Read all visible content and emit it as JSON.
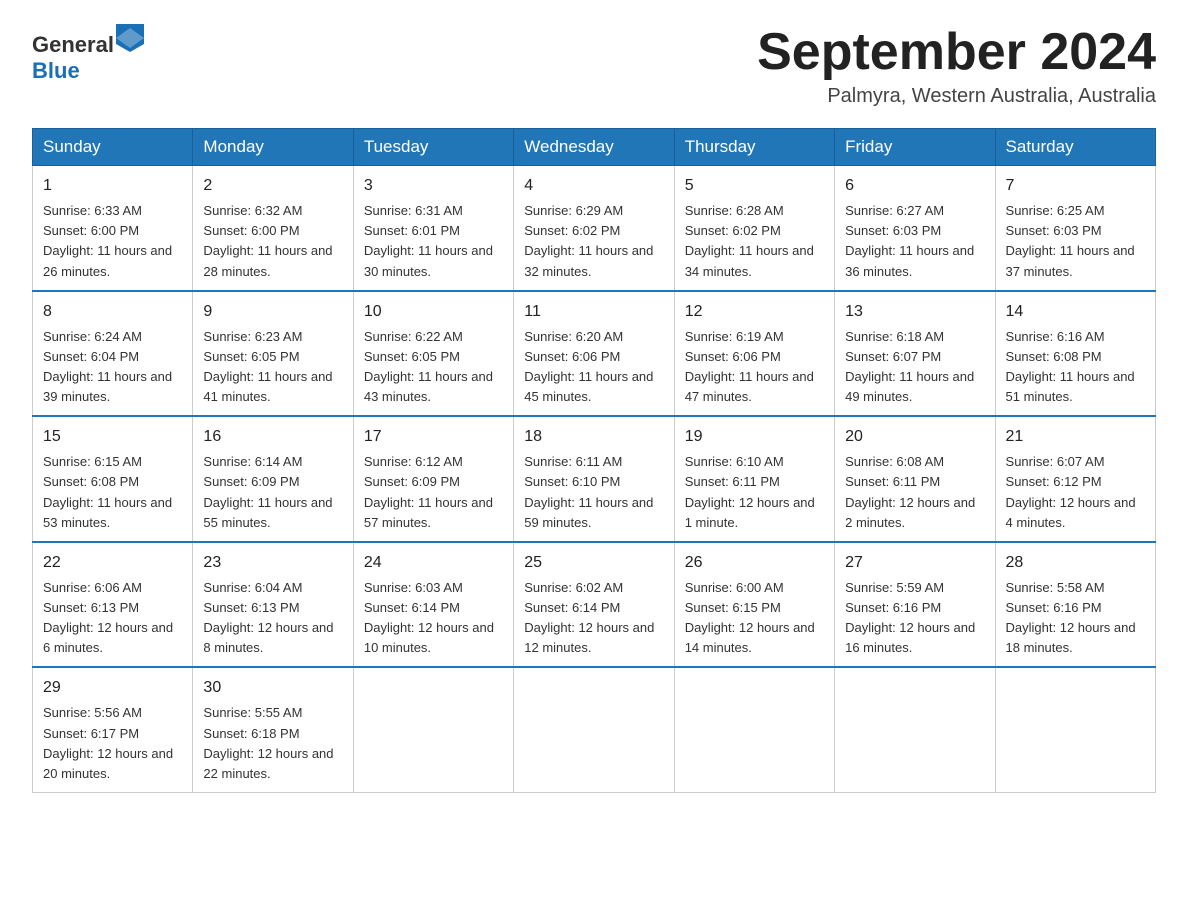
{
  "header": {
    "logo_general": "General",
    "logo_blue": "Blue",
    "month_year": "September 2024",
    "location": "Palmyra, Western Australia, Australia"
  },
  "days_of_week": [
    "Sunday",
    "Monday",
    "Tuesday",
    "Wednesday",
    "Thursday",
    "Friday",
    "Saturday"
  ],
  "weeks": [
    [
      {
        "day": "1",
        "sunrise": "6:33 AM",
        "sunset": "6:00 PM",
        "daylight": "11 hours and 26 minutes."
      },
      {
        "day": "2",
        "sunrise": "6:32 AM",
        "sunset": "6:00 PM",
        "daylight": "11 hours and 28 minutes."
      },
      {
        "day": "3",
        "sunrise": "6:31 AM",
        "sunset": "6:01 PM",
        "daylight": "11 hours and 30 minutes."
      },
      {
        "day": "4",
        "sunrise": "6:29 AM",
        "sunset": "6:02 PM",
        "daylight": "11 hours and 32 minutes."
      },
      {
        "day": "5",
        "sunrise": "6:28 AM",
        "sunset": "6:02 PM",
        "daylight": "11 hours and 34 minutes."
      },
      {
        "day": "6",
        "sunrise": "6:27 AM",
        "sunset": "6:03 PM",
        "daylight": "11 hours and 36 minutes."
      },
      {
        "day": "7",
        "sunrise": "6:25 AM",
        "sunset": "6:03 PM",
        "daylight": "11 hours and 37 minutes."
      }
    ],
    [
      {
        "day": "8",
        "sunrise": "6:24 AM",
        "sunset": "6:04 PM",
        "daylight": "11 hours and 39 minutes."
      },
      {
        "day": "9",
        "sunrise": "6:23 AM",
        "sunset": "6:05 PM",
        "daylight": "11 hours and 41 minutes."
      },
      {
        "day": "10",
        "sunrise": "6:22 AM",
        "sunset": "6:05 PM",
        "daylight": "11 hours and 43 minutes."
      },
      {
        "day": "11",
        "sunrise": "6:20 AM",
        "sunset": "6:06 PM",
        "daylight": "11 hours and 45 minutes."
      },
      {
        "day": "12",
        "sunrise": "6:19 AM",
        "sunset": "6:06 PM",
        "daylight": "11 hours and 47 minutes."
      },
      {
        "day": "13",
        "sunrise": "6:18 AM",
        "sunset": "6:07 PM",
        "daylight": "11 hours and 49 minutes."
      },
      {
        "day": "14",
        "sunrise": "6:16 AM",
        "sunset": "6:08 PM",
        "daylight": "11 hours and 51 minutes."
      }
    ],
    [
      {
        "day": "15",
        "sunrise": "6:15 AM",
        "sunset": "6:08 PM",
        "daylight": "11 hours and 53 minutes."
      },
      {
        "day": "16",
        "sunrise": "6:14 AM",
        "sunset": "6:09 PM",
        "daylight": "11 hours and 55 minutes."
      },
      {
        "day": "17",
        "sunrise": "6:12 AM",
        "sunset": "6:09 PM",
        "daylight": "11 hours and 57 minutes."
      },
      {
        "day": "18",
        "sunrise": "6:11 AM",
        "sunset": "6:10 PM",
        "daylight": "11 hours and 59 minutes."
      },
      {
        "day": "19",
        "sunrise": "6:10 AM",
        "sunset": "6:11 PM",
        "daylight": "12 hours and 1 minute."
      },
      {
        "day": "20",
        "sunrise": "6:08 AM",
        "sunset": "6:11 PM",
        "daylight": "12 hours and 2 minutes."
      },
      {
        "day": "21",
        "sunrise": "6:07 AM",
        "sunset": "6:12 PM",
        "daylight": "12 hours and 4 minutes."
      }
    ],
    [
      {
        "day": "22",
        "sunrise": "6:06 AM",
        "sunset": "6:13 PM",
        "daylight": "12 hours and 6 minutes."
      },
      {
        "day": "23",
        "sunrise": "6:04 AM",
        "sunset": "6:13 PM",
        "daylight": "12 hours and 8 minutes."
      },
      {
        "day": "24",
        "sunrise": "6:03 AM",
        "sunset": "6:14 PM",
        "daylight": "12 hours and 10 minutes."
      },
      {
        "day": "25",
        "sunrise": "6:02 AM",
        "sunset": "6:14 PM",
        "daylight": "12 hours and 12 minutes."
      },
      {
        "day": "26",
        "sunrise": "6:00 AM",
        "sunset": "6:15 PM",
        "daylight": "12 hours and 14 minutes."
      },
      {
        "day": "27",
        "sunrise": "5:59 AM",
        "sunset": "6:16 PM",
        "daylight": "12 hours and 16 minutes."
      },
      {
        "day": "28",
        "sunrise": "5:58 AM",
        "sunset": "6:16 PM",
        "daylight": "12 hours and 18 minutes."
      }
    ],
    [
      {
        "day": "29",
        "sunrise": "5:56 AM",
        "sunset": "6:17 PM",
        "daylight": "12 hours and 20 minutes."
      },
      {
        "day": "30",
        "sunrise": "5:55 AM",
        "sunset": "6:18 PM",
        "daylight": "12 hours and 22 minutes."
      },
      null,
      null,
      null,
      null,
      null
    ]
  ],
  "labels": {
    "sunrise_prefix": "Sunrise: ",
    "sunset_prefix": "Sunset: ",
    "daylight_prefix": "Daylight: "
  }
}
